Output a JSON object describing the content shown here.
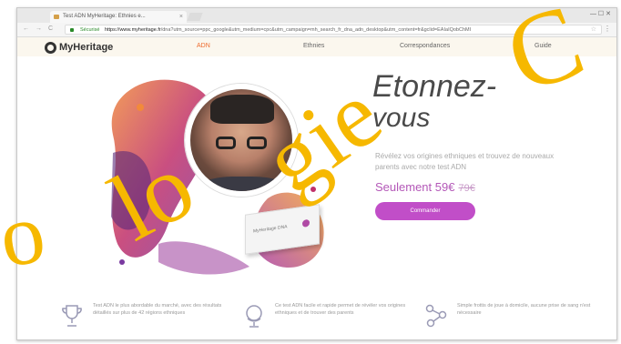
{
  "browser": {
    "tab_title": "Test ADN MyHeritage: Ethnies e...",
    "tab_close": "×",
    "window_controls": "—  ☐  ✕",
    "back": "←",
    "forward": "→",
    "reload": "C",
    "secure_label": "Sécurisé",
    "url_host": "https://www.myheritage.fr",
    "url_rest": "/dna?utm_source=ppc_google&utm_medium=cpc&utm_campaign=mh_search_fr_dna_adn_desktop&utm_content=fr&gclid=EAIaIQobChMI",
    "star": "☆",
    "menu": "⋮"
  },
  "site_nav": {
    "logo_text": "MyHeritage",
    "links": [
      {
        "label": "ADN",
        "active": true
      },
      {
        "label": "Ethnies",
        "active": false
      },
      {
        "label": "Correspondances",
        "active": false
      },
      {
        "label": "Guide",
        "active": false
      }
    ]
  },
  "hero": {
    "headline_line1": "Etonnez-",
    "headline_line2": "vous",
    "subtitle": "Révélez vos origines ethniques et trouvez de nouveaux parents avec notre test ADN",
    "price_label": "Seulement 59€",
    "old_price": "79€",
    "cta_label": "Commander",
    "kit_label": "MyHeritage DNA"
  },
  "features": [
    {
      "icon": "trophy-icon",
      "text": "Test ADN le plus abordable du marché, avec des résultats détaillés sur plus de 42 régions ethniques"
    },
    {
      "icon": "globe-icon",
      "text": "Ce test ADN facile et rapide permet de révéler vos origines ethniques et de trouver des parents"
    },
    {
      "icon": "network-icon",
      "text": "Simple frottis de joue à domicile, aucune prise de sang n'est nécessaire"
    }
  ],
  "watermark": {
    "w1": "o",
    "w2": "lo",
    "w3": "gie",
    "w4": "C"
  },
  "colors": {
    "accent": "#c14ec8",
    "nav_active": "#ee6a2c",
    "watermark": "#f6b800"
  }
}
